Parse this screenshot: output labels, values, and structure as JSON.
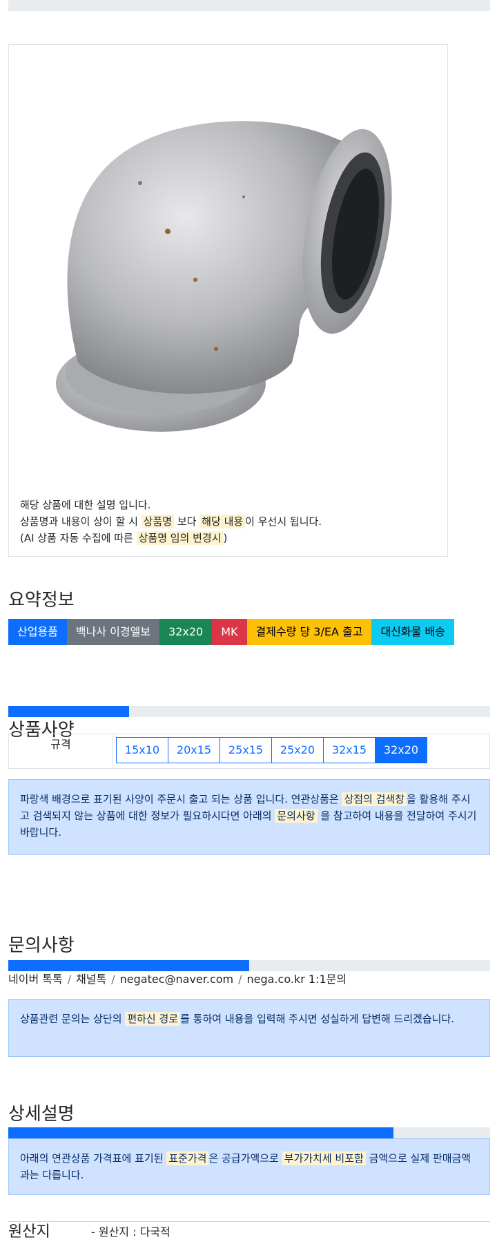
{
  "product_card": {
    "image_alt": "elbow-fitting",
    "desc_line1": "해당 상품에 대한 설명 입니다.",
    "desc_line2_a": "상품명과 내용이 상이 할 시 ",
    "desc_line2_hl1": "상품명",
    "desc_line2_b": " 보다 ",
    "desc_line2_hl2": "해당 내용",
    "desc_line2_c": "이 우선시 됩니다.",
    "desc_line3_a": "(AI 상품 자동 수집에 따른 ",
    "desc_line3_hl": "상품명 임의 변경시",
    "desc_line3_b": ")"
  },
  "summary": {
    "title": "요약정보",
    "badges": [
      {
        "label": "산업용품",
        "color": "#0d6efd"
      },
      {
        "label": "백나사 이경엘보",
        "color": "#6c757d"
      },
      {
        "label": "32x20",
        "color": "#198754"
      },
      {
        "label": "MK",
        "color": "#dc3545"
      },
      {
        "label": "결제수량 당 3/EA 출고",
        "color": "#ffc107"
      },
      {
        "label": "대신화물 배송",
        "color": "#0dcaf0"
      }
    ]
  },
  "spec": {
    "title": "상품사양",
    "label": "규격",
    "options": [
      "15x10",
      "20x15",
      "25x15",
      "25x20",
      "32x15",
      "32x20"
    ],
    "selected": "32x20",
    "notice_a": "파랑색 배경으로 표기된 사양이 주문시 출고 되는 상품 입니다. 연관상품은 ",
    "notice_hl1": "상점의 검색창",
    "notice_b": "을 활용해 주시고 검색되지 않는 상품에 대한 정보가 필요하시다면 아래의 ",
    "notice_hl2": "문의사항",
    "notice_c": " 을 참고하여 내용을 전달하여 주시기 바랍니다."
  },
  "inquiry": {
    "title": "문의사항",
    "links": [
      "네이버 톡톡",
      "채널톡",
      "negatec@naver.com",
      "nega.co.kr 1:1문의"
    ],
    "separator": "/",
    "notice_a": "상품관련 문의는 상단의 ",
    "notice_hl": "편하신 경로",
    "notice_b": "를 통하여 내용을 입력해 주시면 성실하게 답변해 드리겠습니다."
  },
  "detail": {
    "title": "상세설명",
    "notice_a": "아래의 연관상품 가격표에 표기된 ",
    "notice_hl1": "표준가격",
    "notice_b": "은 공급가액으로 ",
    "notice_hl2": "부가가치세 비포함",
    "notice_c": " 금액으로 실제 판매금액과는 다릅니다."
  },
  "origin": {
    "title": "원산지",
    "value": "- 원산지 : 다국적"
  },
  "progress": {
    "spec": 0.25,
    "inquiry": 0.5,
    "detail": 0.8
  }
}
